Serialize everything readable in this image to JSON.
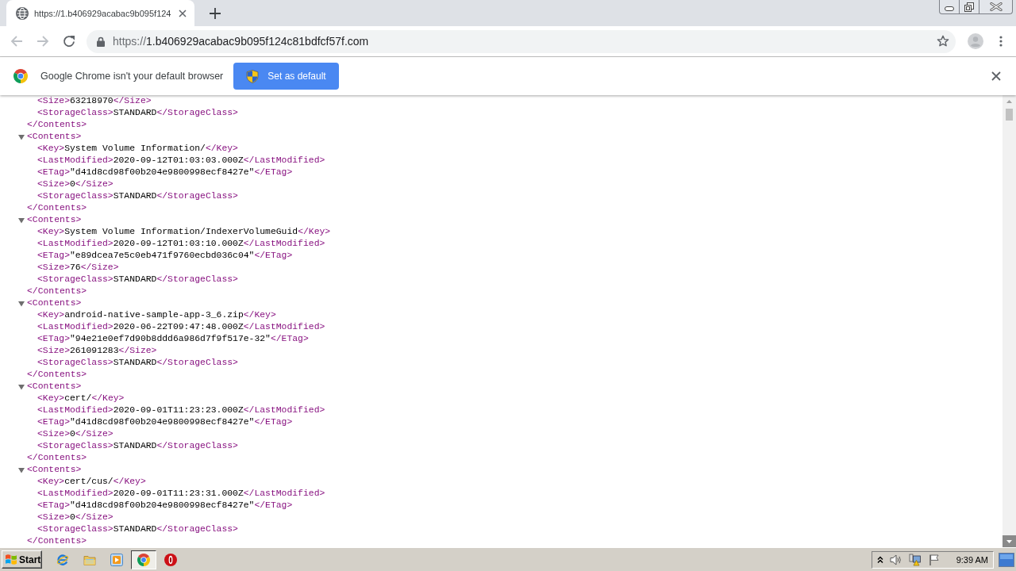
{
  "browser": {
    "tabs": [
      {
        "title": "https://1.b406929acabac9b095f124",
        "selected": true
      }
    ],
    "toolbar": {
      "back": {
        "disabled": true
      },
      "forward": {
        "disabled": true
      }
    },
    "omnibox": {
      "scheme": "https://",
      "host": "1.b406929acabac9b095f124c81bdfcf57f.com"
    }
  },
  "infobar": {
    "message": "Google Chrome isn't your default browser",
    "button": "Set as default"
  },
  "xml": {
    "nodes": [
      {
        "children": [
          {
            "open": "<Size>",
            "text": "63218970",
            "close": "</Size>"
          },
          {
            "open": "<StorageClass>",
            "text": "STANDARD",
            "close": "</StorageClass>"
          }
        ],
        "close": "</Contents>"
      },
      {
        "open": "<Contents>",
        "expanded": true,
        "children": [
          {
            "open": "<Key>",
            "text": "System Volume Information/",
            "close": "</Key>"
          },
          {
            "open": "<LastModified>",
            "text": "2020-09-12T01:03:03.000Z",
            "close": "</LastModified>"
          },
          {
            "open": "<ETag>",
            "text": "\"d41d8cd98f00b204e9800998ecf8427e\"",
            "close": "</ETag>"
          },
          {
            "open": "<Size>",
            "text": "0",
            "close": "</Size>"
          },
          {
            "open": "<StorageClass>",
            "text": "STANDARD",
            "close": "</StorageClass>"
          }
        ],
        "close": "</Contents>"
      },
      {
        "open": "<Contents>",
        "expanded": true,
        "children": [
          {
            "open": "<Key>",
            "text": "System Volume Information/IndexerVolumeGuid",
            "close": "</Key>"
          },
          {
            "open": "<LastModified>",
            "text": "2020-09-12T01:03:10.000Z",
            "close": "</LastModified>"
          },
          {
            "open": "<ETag>",
            "text": "\"e89dcea7e5c0eb471f9760ecbd036c04\"",
            "close": "</ETag>"
          },
          {
            "open": "<Size>",
            "text": "76",
            "close": "</Size>"
          },
          {
            "open": "<StorageClass>",
            "text": "STANDARD",
            "close": "</StorageClass>"
          }
        ],
        "close": "</Contents>"
      },
      {
        "open": "<Contents>",
        "expanded": true,
        "children": [
          {
            "open": "<Key>",
            "text": "android-native-sample-app-3_6.zip",
            "close": "</Key>"
          },
          {
            "open": "<LastModified>",
            "text": "2020-06-22T09:47:48.000Z",
            "close": "</LastModified>"
          },
          {
            "open": "<ETag>",
            "text": "\"94e21e0ef7d90b8ddd6a986d7f9f517e-32\"",
            "close": "</ETag>"
          },
          {
            "open": "<Size>",
            "text": "261091283",
            "close": "</Size>"
          },
          {
            "open": "<StorageClass>",
            "text": "STANDARD",
            "close": "</StorageClass>"
          }
        ],
        "close": "</Contents>"
      },
      {
        "open": "<Contents>",
        "expanded": true,
        "children": [
          {
            "open": "<Key>",
            "text": "cert/",
            "close": "</Key>"
          },
          {
            "open": "<LastModified>",
            "text": "2020-09-01T11:23:23.000Z",
            "close": "</LastModified>"
          },
          {
            "open": "<ETag>",
            "text": "\"d41d8cd98f00b204e9800998ecf8427e\"",
            "close": "</ETag>"
          },
          {
            "open": "<Size>",
            "text": "0",
            "close": "</Size>"
          },
          {
            "open": "<StorageClass>",
            "text": "STANDARD",
            "close": "</StorageClass>"
          }
        ],
        "close": "</Contents>"
      },
      {
        "open": "<Contents>",
        "expanded": true,
        "children": [
          {
            "open": "<Key>",
            "text": "cert/cus/",
            "close": "</Key>"
          },
          {
            "open": "<LastModified>",
            "text": "2020-09-01T11:23:31.000Z",
            "close": "</LastModified>"
          },
          {
            "open": "<ETag>",
            "text": "\"d41d8cd98f00b204e9800998ecf8427e\"",
            "close": "</ETag>"
          },
          {
            "open": "<Size>",
            "text": "0",
            "close": "</Size>"
          },
          {
            "open": "<StorageClass>",
            "text": "STANDARD",
            "close": "</StorageClass>"
          }
        ],
        "close": "</Contents>"
      }
    ]
  },
  "taskbar": {
    "start": "Start",
    "apps": [
      {
        "kind": "ie",
        "selected": false
      },
      {
        "kind": "folder",
        "selected": false
      },
      {
        "kind": "player",
        "selected": false
      },
      {
        "kind": "chrome",
        "selected": true
      },
      {
        "kind": "ring",
        "selected": false
      }
    ],
    "clock": "9:39 AM"
  }
}
